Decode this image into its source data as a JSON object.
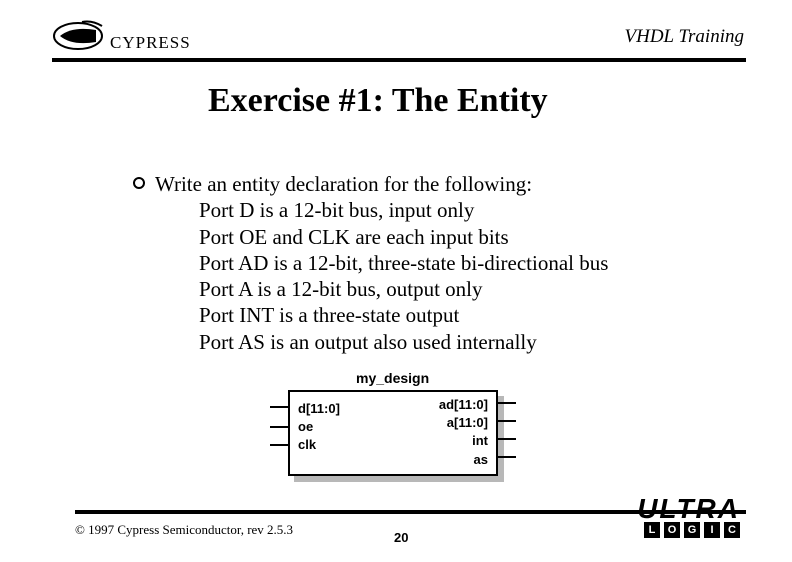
{
  "header": {
    "company": "CYPRESS",
    "topic": "VHDL Training"
  },
  "title": "Exercise #1: The Entity",
  "bullet": "Write an entity declaration for the following:",
  "sub_items": [
    "Port D is a 12-bit bus, input only",
    "Port OE and CLK are each input bits",
    "Port AD is a 12-bit, three-state bi-directional bus",
    "Port A is a 12-bit bus, output only",
    "Port INT is a three-state output",
    "Port AS is an output also used internally"
  ],
  "diagram": {
    "name": "my_design",
    "left_ports": [
      "d[11:0]",
      "oe",
      "clk"
    ],
    "right_ports": [
      "ad[11:0]",
      "a[11:0]",
      "int",
      "as"
    ]
  },
  "footer": {
    "copyright": "© 1997 Cypress Semiconductor, rev 2.5.3",
    "page": "20",
    "brand": "ULTRA",
    "brand_boxes": [
      "L",
      "O",
      "G",
      "I",
      "C"
    ]
  }
}
